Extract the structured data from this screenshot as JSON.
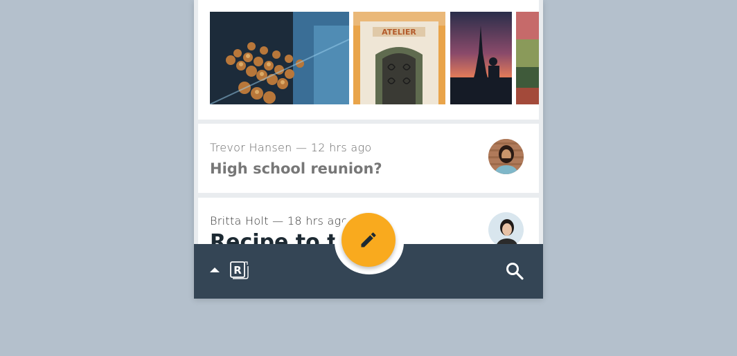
{
  "gallery": {
    "images": [
      {
        "name": "pastries-photo"
      },
      {
        "name": "atelier-doorway-photo",
        "sign_text": "ATELIER"
      },
      {
        "name": "eiffel-tower-silhouette-photo"
      },
      {
        "name": "market-photo"
      }
    ]
  },
  "messages": [
    {
      "author": "Trevor Hansen",
      "time": "12 hrs ago",
      "separator": "—",
      "subject": "High school reunion?",
      "avatar_icon": "avatar-trevor"
    },
    {
      "author": "Britta Holt",
      "time": "18 hrs ago",
      "separator": "—",
      "subject": "Recipe to try",
      "avatar_icon": "avatar-britta"
    }
  ],
  "bottom_bar": {
    "menu_icon": "caret-up-icon",
    "logo_letter": "R",
    "search_icon": "search-icon"
  },
  "fab": {
    "icon": "pencil-icon"
  },
  "colors": {
    "background": "#b4c0cc",
    "bottom_bar": "#344555",
    "fab": "#f9aa1e",
    "title_dark": "#1d2a33"
  }
}
